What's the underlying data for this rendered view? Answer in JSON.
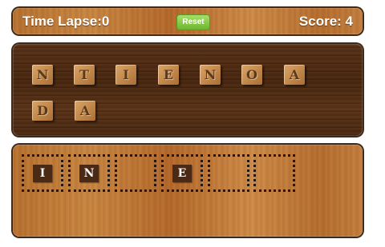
{
  "header": {
    "time_lapse": "Time Lapse:0",
    "reset_label": "Reset",
    "score": "Score: 4"
  },
  "scramble_tiles": [
    "N",
    "T",
    "I",
    "E",
    "N",
    "O",
    "A",
    "D",
    "A"
  ],
  "answer_slots": [
    "I",
    "N",
    "",
    "E",
    "",
    ""
  ],
  "colors": {
    "reset_button": "#7cc33a",
    "placed_tile": "#4a2a14",
    "dark_board": "#4f2c13",
    "light_board": "#c07c3a"
  }
}
